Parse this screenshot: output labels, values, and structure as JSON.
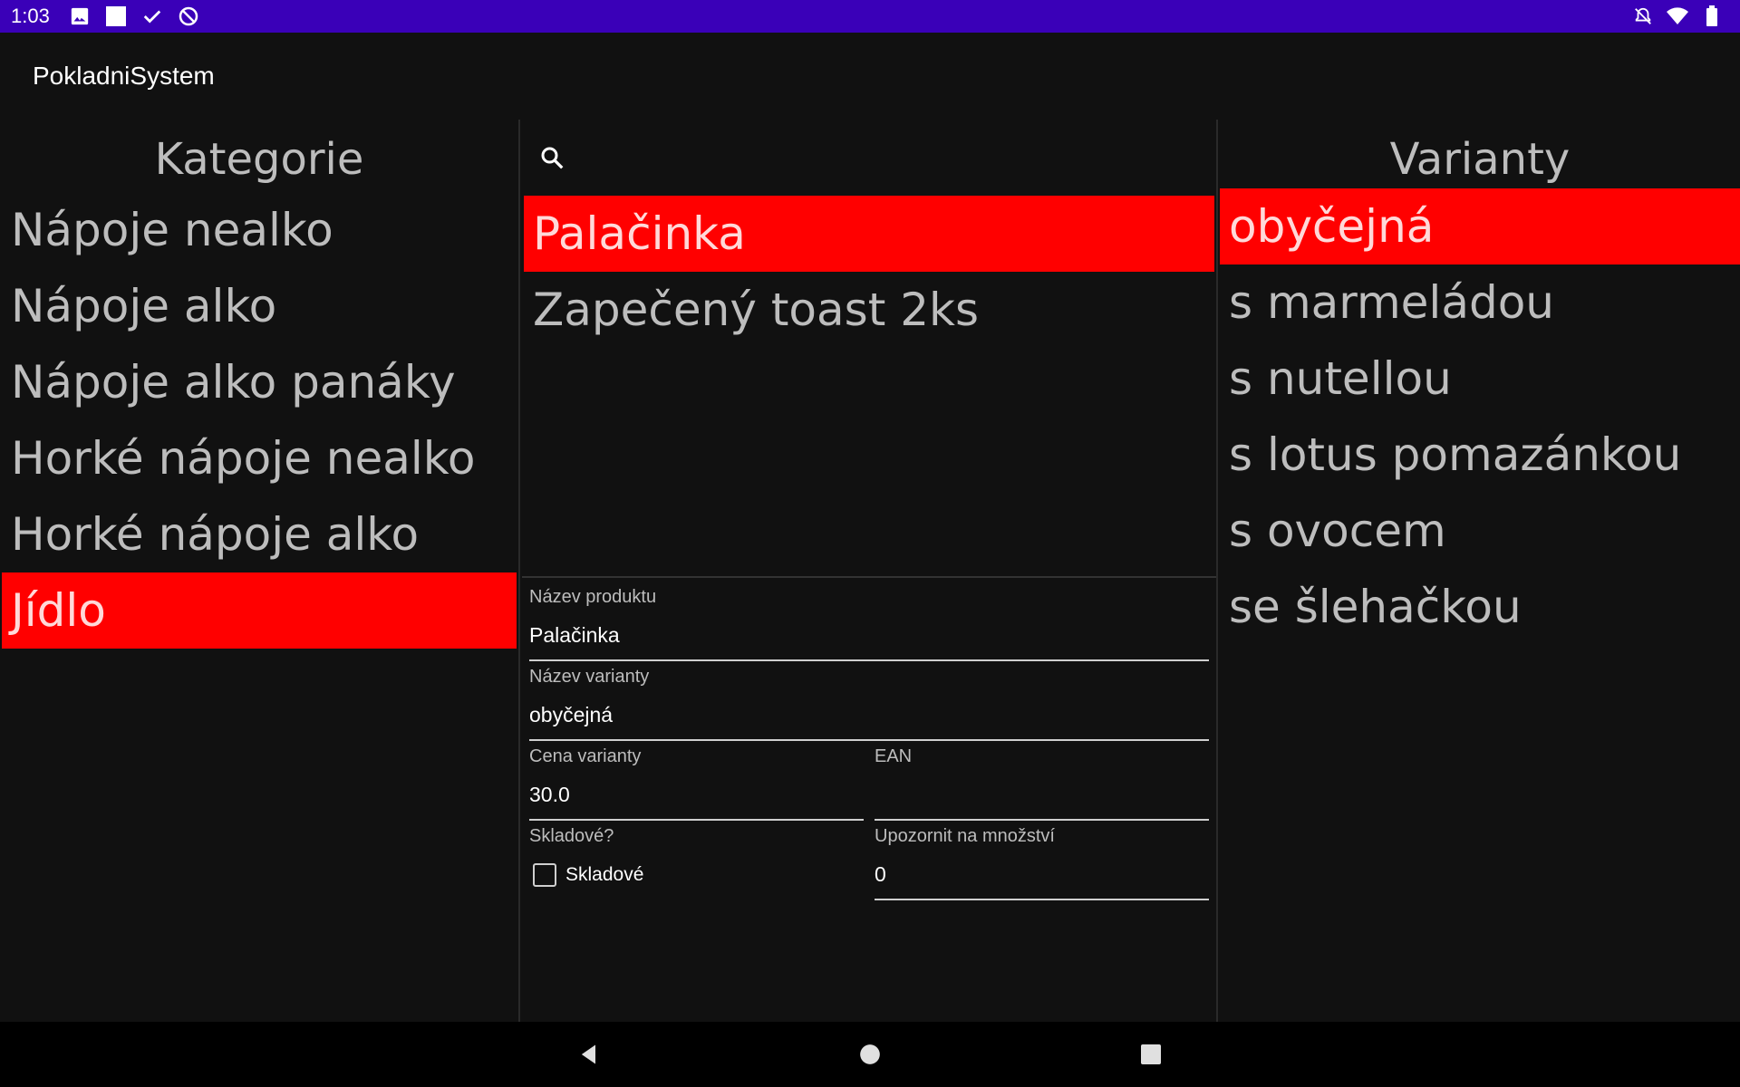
{
  "status_bar": {
    "time": "1:03",
    "left_icons": [
      "image-icon",
      "square-icon",
      "check-icon",
      "sync-blocked-icon"
    ],
    "right_icons": [
      "notifications-off-icon",
      "wifi-icon",
      "battery-icon"
    ]
  },
  "app": {
    "title": "PokladniSystem"
  },
  "categories": {
    "header": "Kategorie",
    "items": [
      {
        "label": "Nápoje nealko",
        "selected": false
      },
      {
        "label": "Nápoje alko",
        "selected": false
      },
      {
        "label": "Nápoje alko panáky",
        "selected": false
      },
      {
        "label": "Horké nápoje nealko",
        "selected": false
      },
      {
        "label": "Horké nápoje alko",
        "selected": false
      },
      {
        "label": "Jídlo",
        "selected": true
      }
    ]
  },
  "products": {
    "search_placeholder": "",
    "items": [
      {
        "label": "Palačinka",
        "selected": true
      },
      {
        "label": "Zapečený toast 2ks",
        "selected": false
      }
    ]
  },
  "form": {
    "product_name_label": "Název produktu",
    "product_name_value": "Palačinka",
    "variant_name_label": "Název varianty",
    "variant_name_value": "obyčejná",
    "variant_price_label": "Cena varianty",
    "variant_price_value": "30.0",
    "ean_label": "EAN",
    "ean_value": "",
    "stock_label": "Skladové?",
    "stock_checkbox_label": "Skladové",
    "stock_checked": false,
    "notify_label": "Upozornit na množství",
    "notify_value": "0"
  },
  "variants": {
    "header": "Varianty",
    "items": [
      {
        "label": "obyčejná",
        "selected": true
      },
      {
        "label": "s marmeládou",
        "selected": false
      },
      {
        "label": "s nutellou",
        "selected": false
      },
      {
        "label": "s lotus pomazánkou",
        "selected": false
      },
      {
        "label": "s ovocem",
        "selected": false
      },
      {
        "label": "se šlehačkou",
        "selected": false
      }
    ]
  },
  "nav_bar": {
    "icons": [
      "back-icon",
      "home-icon",
      "recents-icon"
    ]
  },
  "colors": {
    "status_bar": "#3a00b8",
    "selected": "#ff0000",
    "background": "#111111"
  }
}
